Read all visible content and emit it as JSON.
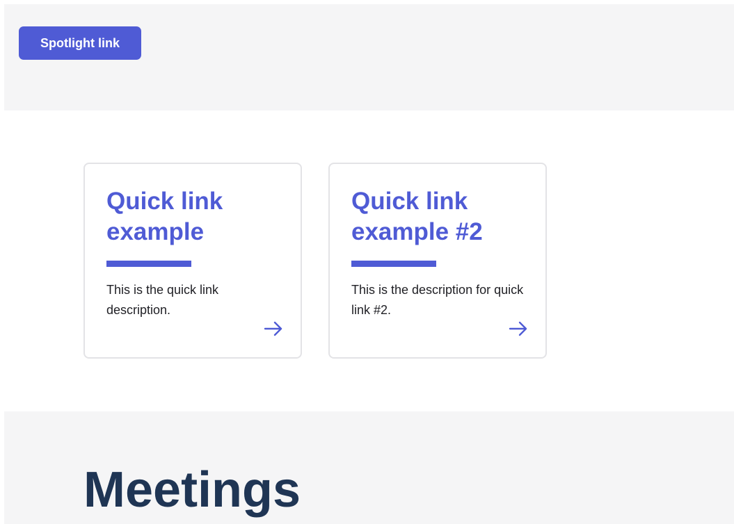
{
  "colors": {
    "accent": "#4f5bd5",
    "band_background": "#f5f5f6",
    "card_border": "#e3e3e6",
    "heading_dark": "#1f3554",
    "body_text": "#1f1f24"
  },
  "spotlight": {
    "label": "Spotlight link"
  },
  "quick_links": [
    {
      "title": "Quick link example",
      "description": "This is the quick link description.",
      "icon": "arrow-right-icon"
    },
    {
      "title": "Quick link example #2",
      "description": "This is the description for quick link #2.",
      "icon": "arrow-right-icon"
    }
  ],
  "meetings": {
    "title": "Meetings"
  }
}
